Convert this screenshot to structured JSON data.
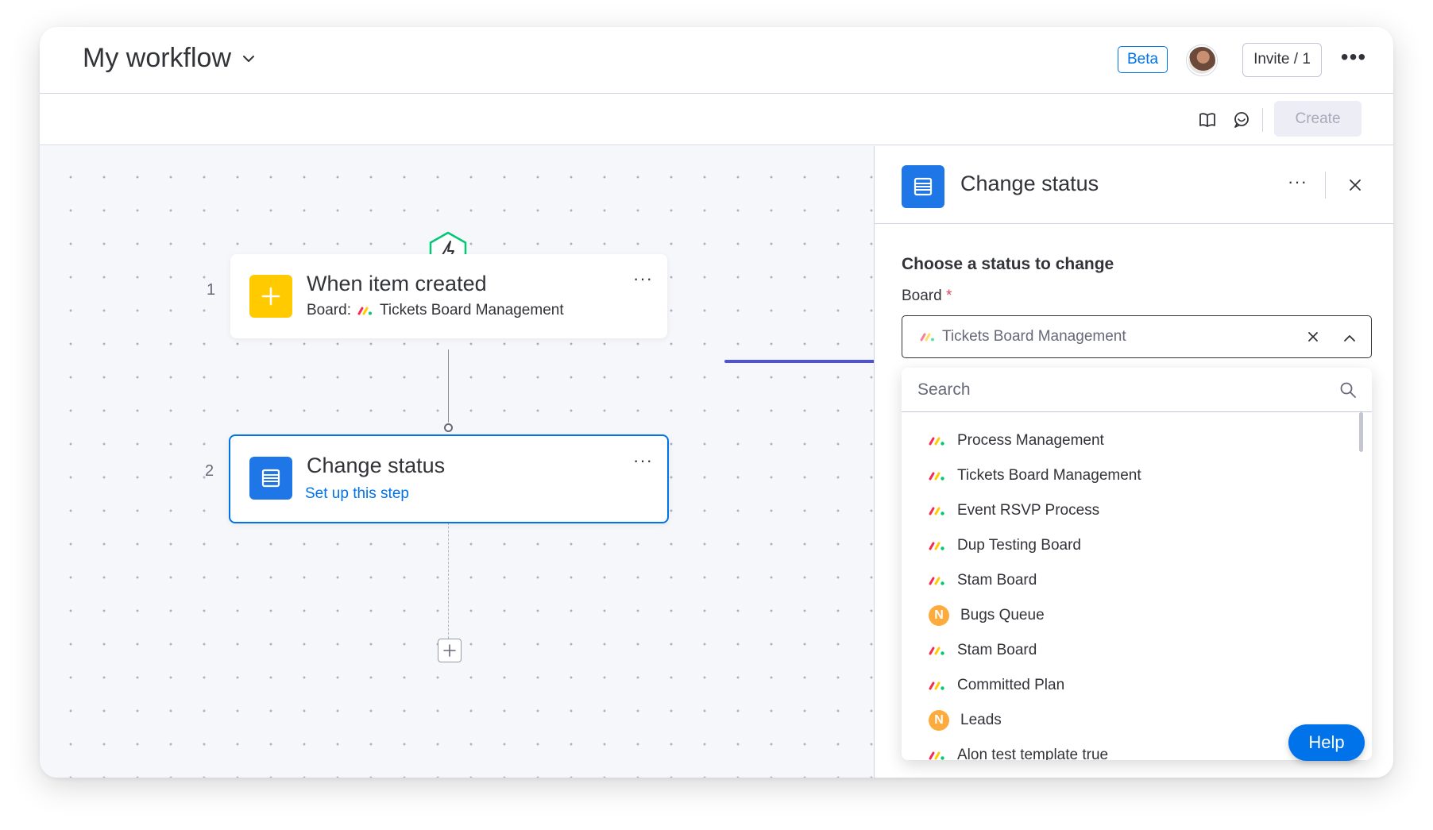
{
  "header": {
    "workflow_title": "My workflow",
    "beta_label": "Beta",
    "invite_label": "Invite / 1",
    "more_label": "•••"
  },
  "toolbar": {
    "create_label": "Create"
  },
  "canvas": {
    "steps": [
      {
        "number": "1",
        "title": "When item created",
        "board_prefix": "Board:",
        "board_name": "Tickets Board Management",
        "dots": "···"
      },
      {
        "number": "2",
        "title": "Change status",
        "link": "Set up this step",
        "dots": "···"
      }
    ]
  },
  "panel": {
    "title": "Change status",
    "dots": "···",
    "section_title": "Choose a status to change",
    "board_label": "Board",
    "required_mark": "*",
    "selected_board": "Tickets Board Management",
    "search_placeholder": "Search",
    "boards": [
      {
        "name": "Process Management",
        "icon": "monday-logo-icon"
      },
      {
        "name": "Tickets Board Management",
        "icon": "monday-logo-icon"
      },
      {
        "name": "Event RSVP Process",
        "icon": "monday-logo-icon"
      },
      {
        "name": "Dup Testing Board",
        "icon": "monday-logo-icon"
      },
      {
        "name": "Stam Board",
        "icon": "monday-logo-icon"
      },
      {
        "name": "Bugs Queue",
        "icon": "n-badge-icon",
        "badge": "N"
      },
      {
        "name": "Stam Board",
        "icon": "monday-logo-icon"
      },
      {
        "name": "Committed Plan",
        "icon": "monday-logo-icon"
      },
      {
        "name": "Leads",
        "icon": "n-badge-icon",
        "badge": "N"
      },
      {
        "name": "Alon test template true",
        "icon": "monday-logo-icon"
      }
    ]
  },
  "help_label": "Help",
  "colors": {
    "accent": "#0073ea",
    "trigger_icon_bg": "#ffcb00",
    "action_icon_bg": "#1f76e6",
    "arrow": "#4f52d9",
    "hex_green": "#00c875"
  }
}
